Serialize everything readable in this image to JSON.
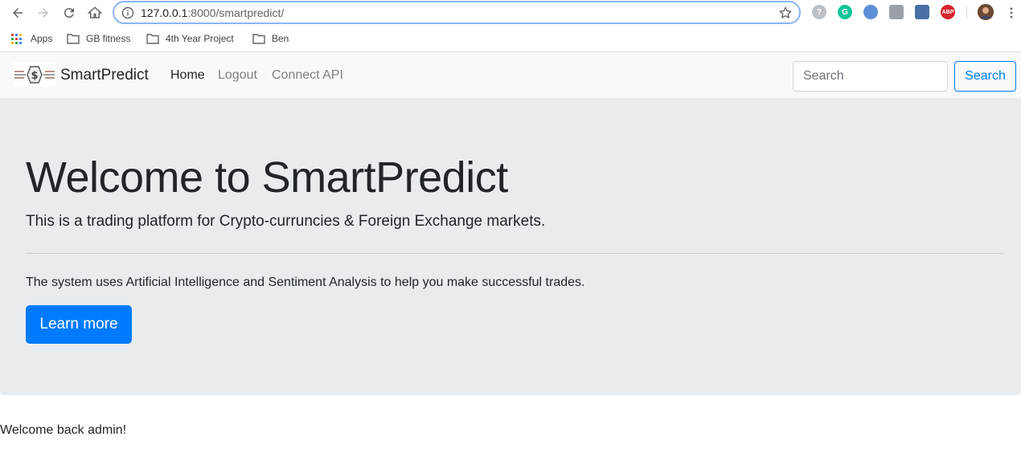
{
  "browser": {
    "url_host": "127.0.0.1",
    "url_rest": ":8000/smartpredict/",
    "bookmarks": [
      {
        "label": "Apps"
      },
      {
        "label": "GB fitness"
      },
      {
        "label": "4th Year Project"
      },
      {
        "label": "Ben"
      }
    ],
    "extensions": [
      {
        "name": "help-extension-icon",
        "text": "?",
        "color": "#bdc1c6"
      },
      {
        "name": "grammarly-extension-icon",
        "text": "G",
        "color": "#15c39a"
      },
      {
        "name": "blue-extension-icon",
        "text": "",
        "color": "#5b8fd6"
      },
      {
        "name": "gray-extension-icon",
        "text": "",
        "color": "#9aa0a6"
      },
      {
        "name": "puzzle-extension-icon",
        "text": "",
        "color": "#4a6fa5"
      },
      {
        "name": "adblock-plus-extension-icon",
        "text": "ABP",
        "color": "#d9232d"
      }
    ]
  },
  "site_nav": {
    "brand": "SmartPredict",
    "links": [
      {
        "label": "Home",
        "active": true
      },
      {
        "label": "Logout",
        "active": false
      },
      {
        "label": "Connect API",
        "active": false
      }
    ],
    "search_placeholder": "Search",
    "search_button": "Search"
  },
  "jumbotron": {
    "title": "Welcome to SmartPredict",
    "lead": "This is a trading platform for Crypto-curruncies & Foreign Exchange markets.",
    "text": "The system uses Artificial Intelligence and Sentiment Analysis to help you make successful trades.",
    "button": "Learn more"
  },
  "welcome_message": "Welcome back admin!",
  "colors": {
    "primary": "#007bff",
    "navbar_bg": "#f8f9fa",
    "jumbotron_bg": "#e9ecef",
    "nav_link_muted": "#7f7f7f"
  }
}
